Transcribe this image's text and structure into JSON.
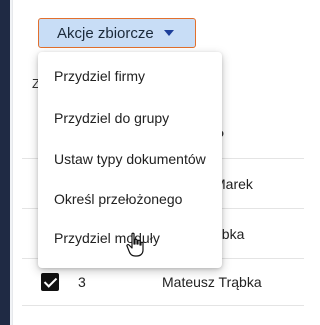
{
  "toolbar": {
    "bulk_actions_label": "Akcje zbiorcze"
  },
  "background": {
    "partial_label": "Z",
    "column_header_partial": "isko",
    "rows": [
      {
        "name_partial": "Marek"
      },
      {
        "name_partial": "ąbka"
      },
      {
        "number": "3",
        "name": "Mateusz Trąbka"
      }
    ]
  },
  "menu": {
    "items": [
      {
        "label": "Przydziel firmy"
      },
      {
        "label": "Przydziel do grupy"
      },
      {
        "label": "Ustaw typy dokumentów"
      },
      {
        "label": "Określ przełożonego"
      },
      {
        "label": "Przydziel moduły"
      }
    ]
  },
  "colors": {
    "button_bg": "#c8ddf6",
    "button_border": "#e2702d",
    "caret": "#1d3f9a",
    "nav_bg": "#1f2a44"
  }
}
